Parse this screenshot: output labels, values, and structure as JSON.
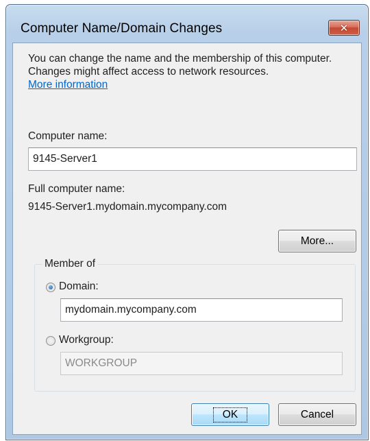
{
  "window": {
    "title": "Computer Name/Domain Changes",
    "close_glyph": "✕"
  },
  "intro": {
    "text": "You can change the name and the membership of this computer. Changes might affect access to network resources.",
    "link": "More information"
  },
  "computer_name": {
    "label": "Computer name:",
    "value": "9145-Server1"
  },
  "full_name": {
    "label": "Full computer name:",
    "value": "9145-Server1.mydomain.mycompany.com"
  },
  "more_button": "More...",
  "member_of": {
    "legend": "Member of",
    "domain": {
      "label": "Domain:",
      "value": "mydomain.mycompany.com",
      "selected": true
    },
    "workgroup": {
      "label": "Workgroup:",
      "value": "WORKGROUP",
      "selected": false
    }
  },
  "buttons": {
    "ok": "OK",
    "cancel": "Cancel"
  },
  "colors": {
    "link": "#0066cc",
    "titlebar": "#b7cfe8",
    "close": "#c34a35"
  }
}
